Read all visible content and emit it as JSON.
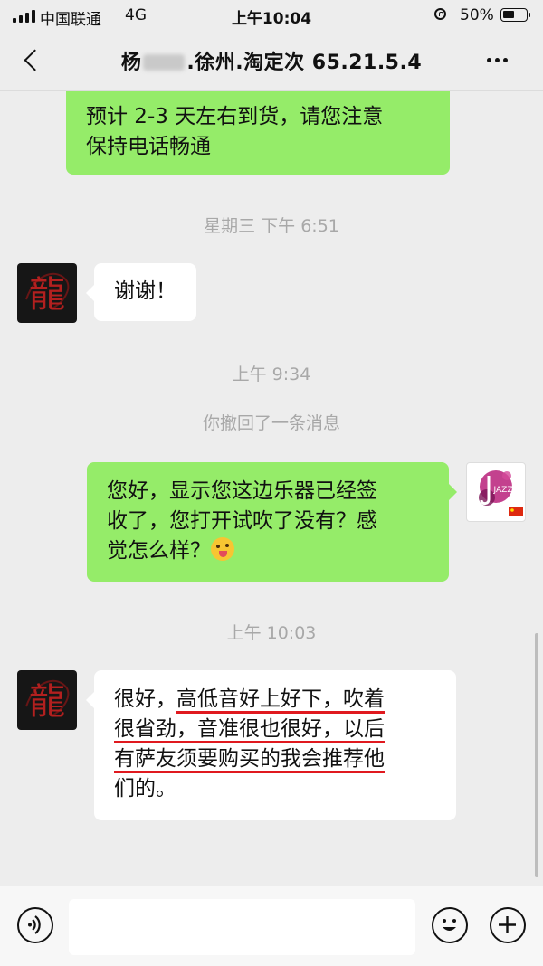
{
  "status_bar": {
    "carrier": "中国联通",
    "network": "4G",
    "time": "上午10:04",
    "battery": "50%"
  },
  "header": {
    "title_prefix": "杨",
    "title_suffix": ".徐州.淘定次 65.21.5.4"
  },
  "messages": {
    "m1": {
      "line1": "预计 2-3 天左右到货，请您注意",
      "line2": "保持电话畅通"
    },
    "t1": "星期三 下午 6:51",
    "m2": "谢谢！",
    "t2": "上午 9:34",
    "recall": "你撤回了一条消息",
    "m3": {
      "line1": "您好，显示您这边乐器已经签",
      "line2": "收了，您打开试吹了没有？感",
      "line3": "觉怎么样？"
    },
    "t3": "上午 10:03",
    "m4": {
      "l1a": "很好，",
      "l1b": "高低音好上好下，吹着",
      "l2": "很省劲，音准很也很好，以后",
      "l3": "有萨友须要购买的我会推荐他",
      "l4": "们的。"
    }
  },
  "avatars": {
    "dragon_glyph": "龍",
    "jazz_text": "JAZZ"
  },
  "colors": {
    "sent_bubble": "#95ec69",
    "received_bubble": "#ffffff",
    "background": "#ededed",
    "underline": "#e0191f"
  }
}
